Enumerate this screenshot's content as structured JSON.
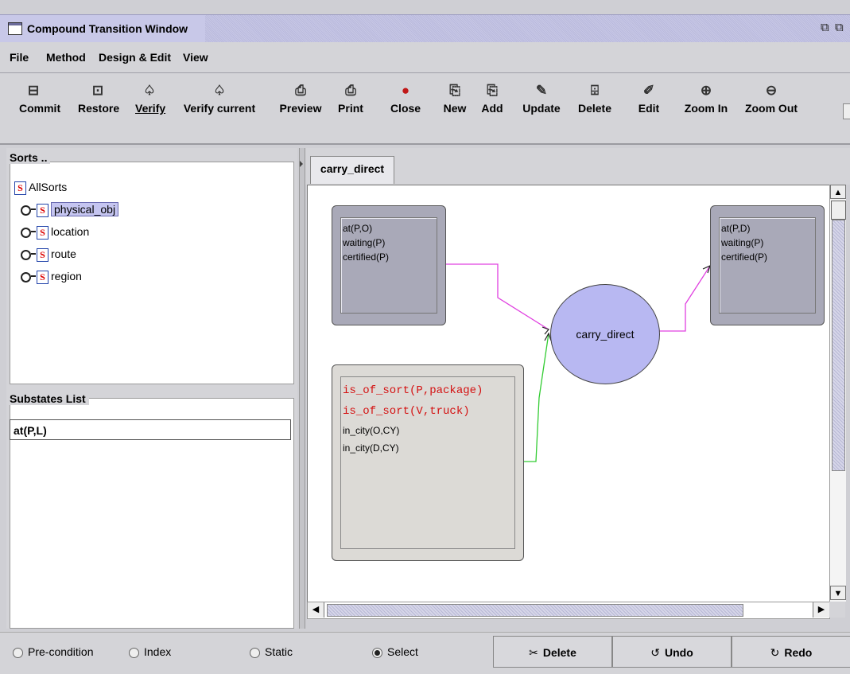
{
  "window": {
    "title": "Compound Transition Window"
  },
  "menu": [
    "File",
    "Method",
    "Design & Edit",
    "View"
  ],
  "toolbar": [
    {
      "label": "Commit",
      "icon": "commit-icon",
      "glyph": "⊟"
    },
    {
      "label": "Restore",
      "icon": "restore-icon",
      "glyph": "⊡"
    },
    {
      "label": "Verify",
      "icon": "verify-icon",
      "glyph": "♤"
    },
    {
      "label": "Verify current",
      "icon": "verify-current-icon",
      "glyph": "♤"
    },
    {
      "label": "Preview",
      "icon": "preview-icon",
      "glyph": "⎙"
    },
    {
      "label": "Print",
      "icon": "print-icon",
      "glyph": "⎙"
    },
    {
      "label": "Close",
      "icon": "close-icon",
      "glyph": "●"
    },
    {
      "label": "New",
      "icon": "new-icon",
      "glyph": "⎘"
    },
    {
      "label": "Add",
      "icon": "add-icon",
      "glyph": "⎘"
    },
    {
      "label": "Update",
      "icon": "update-icon",
      "glyph": "✎"
    },
    {
      "label": "Delete",
      "icon": "trash-icon",
      "glyph": "🗑"
    },
    {
      "label": "Edit",
      "icon": "edit-icon",
      "glyph": "✐"
    },
    {
      "label": "Zoom In",
      "icon": "zoom-in-icon",
      "glyph": "⊕"
    },
    {
      "label": "Zoom Out",
      "icon": "zoom-out-icon",
      "glyph": "⊖"
    }
  ],
  "sorts": {
    "title": "Sorts ..",
    "root": "AllSorts",
    "items": [
      "physical_obj",
      "location",
      "route",
      "region"
    ]
  },
  "substates": {
    "title": "Substates List",
    "value": "at(P,L)"
  },
  "tab": "carry_direct",
  "diagram": {
    "left_state": [
      "at(P,O)",
      "waiting(P)",
      "certified(P)"
    ],
    "right_state": [
      "at(P,D)",
      "waiting(P)",
      "certified(P)"
    ],
    "static_red": [
      "is_of_sort(P,package)",
      "is_of_sort(V,truck)"
    ],
    "static_black": [
      "in_city(O,CY)",
      "in_city(D,CY)"
    ],
    "transition": "carry_direct",
    "colors": {
      "edge_in": "#e040e0",
      "edge_static": "#33cc33"
    }
  },
  "bottom": {
    "radios": [
      "Pre-condition",
      "Index",
      "Static",
      "Select"
    ],
    "selected": "Select",
    "buttons": [
      {
        "label": "Delete",
        "glyph": "✂"
      },
      {
        "label": "Undo",
        "glyph": "↺"
      },
      {
        "label": "Redo",
        "glyph": "↻"
      }
    ]
  }
}
